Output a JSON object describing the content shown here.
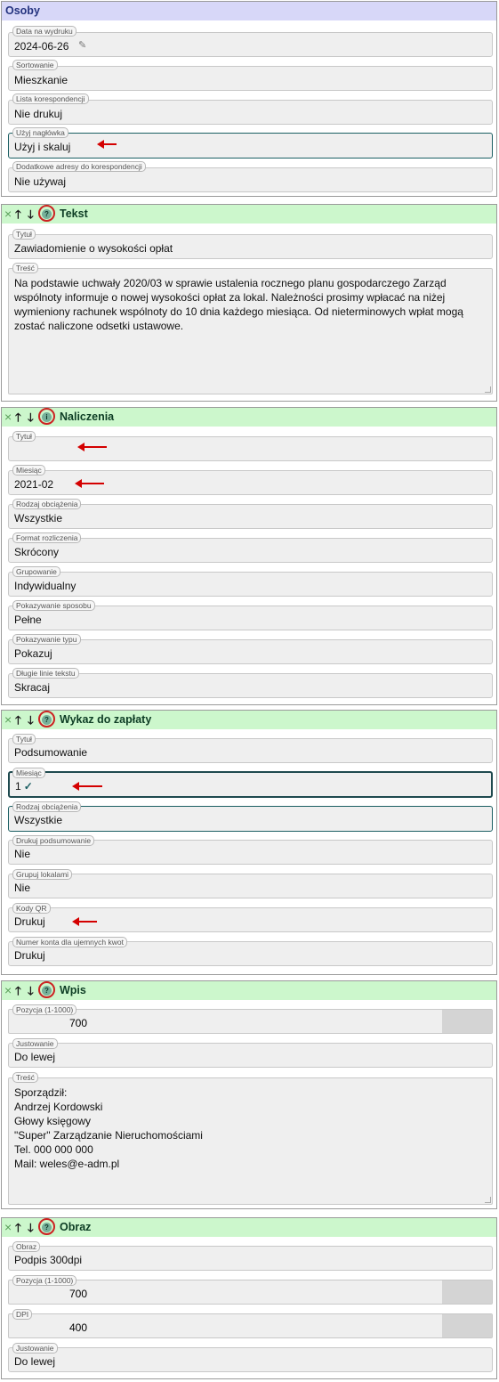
{
  "osoby": {
    "title": "Osoby",
    "data_label": "Data na wydruku",
    "data_value": "2024-06-26",
    "sort_label": "Sortowanie",
    "sort_value": "Mieszkanie",
    "lista_label": "Lista korespondencji",
    "lista_value": "Nie drukuj",
    "naglowek_label": "Użyj nagłówka",
    "naglowek_value": "Użyj i skaluj",
    "adresy_label": "Dodatkowe adresy do korespondencji",
    "adresy_value": "Nie używaj"
  },
  "tekst": {
    "title": "Tekst",
    "tytul_label": "Tytuł",
    "tytul_value": "Zawiadomienie o wysokości opłat",
    "tresc_label": "Treść",
    "tresc_value": "Na podstawie uchwały 2020/03 w sprawie ustalenia rocznego planu gospodarczego Zarząd wspólnoty informuje o nowej wysokości opłat za lokal. Należności prosimy wpłacać na niżej wymieniony rachunek wspólnoty do 10 dnia każdego miesiąca. Od nieterminowych wpłat mogą zostać naliczone odsetki ustawowe."
  },
  "naliczenia": {
    "title": "Naliczenia",
    "tytul_label": "Tytuł",
    "tytul_value": "",
    "miesiac_label": "Miesiąc",
    "miesiac_value": "2021-02",
    "rodzaj_label": "Rodzaj obciążenia",
    "rodzaj_value": "Wszystkie",
    "format_label": "Format rozliczenia",
    "format_value": "Skrócony",
    "grupowanie_label": "Grupowanie",
    "grupowanie_value": "Indywidualny",
    "sposob_label": "Pokazywanie sposobu",
    "sposob_value": "Pełne",
    "typ_label": "Pokazywanie typu",
    "typ_value": "Pokazuj",
    "linie_label": "Długie linie tekstu",
    "linie_value": "Skracaj"
  },
  "wykaz": {
    "title": "Wykaz do zapłaty",
    "tytul_label": "Tytuł",
    "tytul_value": "Podsumowanie",
    "miesiac_label": "Miesiąc",
    "miesiac_value": "1",
    "rodzaj_label": "Rodzaj obciążenia",
    "rodzaj_value": "Wszystkie",
    "podsum_label": "Drukuj podsumowanie",
    "podsum_value": "Nie",
    "grupuj_label": "Grupuj lokalami",
    "grupuj_value": "Nie",
    "qr_label": "Kody QR",
    "qr_value": "Drukuj",
    "konto_label": "Numer konta dla ujemnych kwot",
    "konto_value": "Drukuj"
  },
  "wpis": {
    "title": "Wpis",
    "pozycja_label": "Pozycja (1-1000)",
    "pozycja_value": "700",
    "justowanie_label": "Justowanie",
    "justowanie_value": "Do lewej",
    "tresc_label": "Treść",
    "tresc_lines": [
      "Sporządził:",
      "Andrzej Kordowski",
      "Głowy księgowy",
      "\"Super\" Zarządzanie Nieruchomościami",
      "Tel. 000 000 000",
      "Mail: weles@e-adm.pl"
    ]
  },
  "obraz": {
    "title": "Obraz",
    "obraz_label": "Obraz",
    "obraz_value": "Podpis 300dpi",
    "pozycja_label": "Pozycja (1-1000)",
    "pozycja_value": "700",
    "dpi_label": "DPI",
    "dpi_value": "400",
    "justowanie_label": "Justowanie",
    "justowanie_value": "Do lewej"
  },
  "controls": {
    "remove": "×",
    "up": "🡑",
    "down": "🡓",
    "help": "?",
    "info": "i",
    "check": "✓",
    "edit": "✎"
  },
  "colors": {
    "annotation_red": "#d40000",
    "header_green": "#ccf7cc",
    "header_blue": "#d7d7f8",
    "focus_teal": "#1b5f63"
  }
}
